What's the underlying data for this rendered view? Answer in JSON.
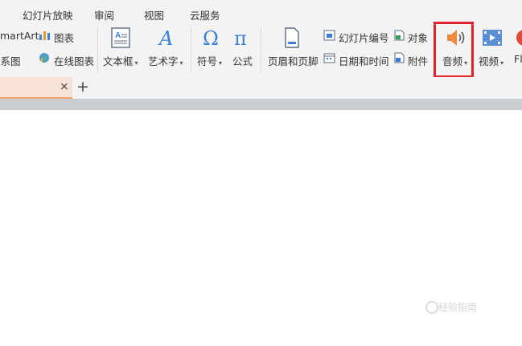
{
  "menubar": {
    "items": [
      "幻灯片放映",
      "审阅",
      "视图",
      "云服务"
    ]
  },
  "ribbon": {
    "smartart_label": "martArt",
    "chart_label": "图表",
    "relation_label": "关系图",
    "online_chart_label": "在线图表",
    "textbox_label": "文本框",
    "wordart_label": "艺术字",
    "symbol_label": "符号",
    "formula_label": "公式",
    "header_footer_label": "页眉和页脚",
    "slide_number_label": "幻灯片编号",
    "object_label": "对象",
    "datetime_label": "日期和时间",
    "attachment_label": "附件",
    "audio_label": "音频",
    "video_label": "视频",
    "flash_label": "Fl",
    "dropdown_caret": "▾"
  },
  "tabs": {
    "close_symbol": "×",
    "add_symbol": "+"
  },
  "watermark": {
    "text": "经验指南"
  },
  "colors": {
    "highlight": "#e0262c",
    "tab_accent": "#f0a36c",
    "icon_blue": "#3b7fd9",
    "audio_orange": "#f08a3a"
  }
}
